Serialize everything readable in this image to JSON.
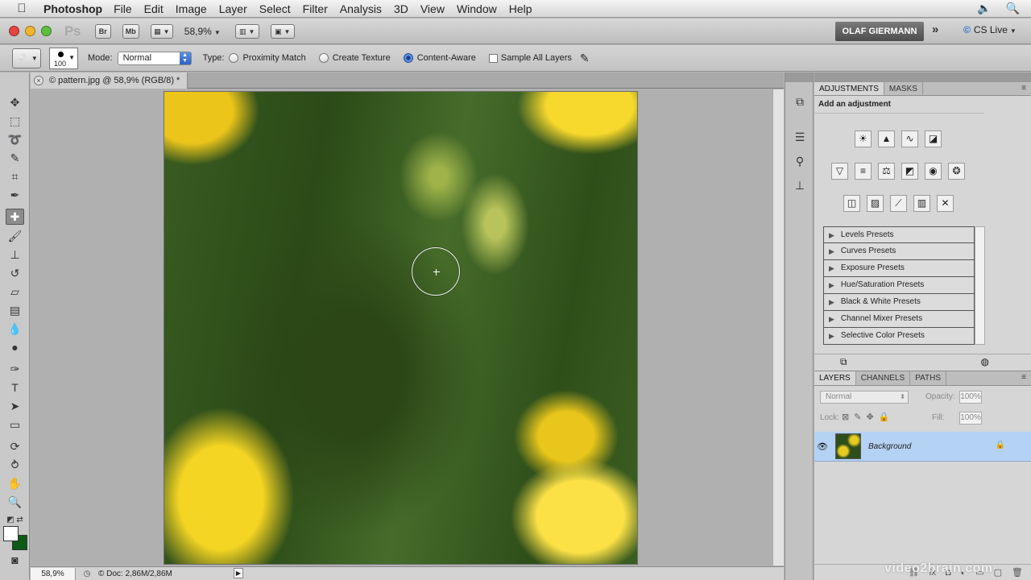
{
  "menubar": {
    "apple_icon": "apple-icon",
    "app_name": "Photoshop",
    "items": [
      "File",
      "Edit",
      "Image",
      "Layer",
      "Select",
      "Filter",
      "Analysis",
      "3D",
      "View",
      "Window",
      "Help"
    ],
    "volume_icon": "volume-icon",
    "search_icon": "spotlight-search-icon"
  },
  "appbar": {
    "ps_logo": "Ps",
    "bridge_label": "Br",
    "minibridge_label": "Mb",
    "zoom_level": "58,9%",
    "user_name": "OLAF GIERMANN",
    "expand_label": "»",
    "cs_live_label": "CS Live"
  },
  "options": {
    "brush_size": "100",
    "mode_label": "Mode:",
    "mode_value": "Normal",
    "type_label": "Type:",
    "types": [
      {
        "label": "Proximity Match",
        "checked": false
      },
      {
        "label": "Create Texture",
        "checked": false
      },
      {
        "label": "Content-Aware",
        "checked": true
      }
    ],
    "sample_all_layers_label": "Sample All Layers"
  },
  "document": {
    "tab_title": "© pattern.jpg @ 58,9% (RGB/8) *",
    "status_zoom": "58,9%",
    "status_doc": "© Doc: 2,86M/2,86M"
  },
  "colors": {
    "foreground": "#ffffff",
    "background": "#0d5a16",
    "selection_blue": "#b4d2f3"
  },
  "adjustments": {
    "tabs": [
      "ADJUSTMENTS",
      "MASKS"
    ],
    "title": "Add an adjustment",
    "presets": [
      "Levels Presets",
      "Curves Presets",
      "Exposure Presets",
      "Hue/Saturation Presets",
      "Black & White Presets",
      "Channel Mixer Presets",
      "Selective Color Presets"
    ]
  },
  "layers": {
    "tabs": [
      "LAYERS",
      "CHANNELS",
      "PATHS"
    ],
    "blend_mode": "Normal",
    "opacity_label": "Opacity:",
    "opacity_value": "100%",
    "lock_label": "Lock:",
    "fill_label": "Fill:",
    "fill_value": "100%",
    "items": [
      {
        "name": "Background",
        "visible": true,
        "locked": true
      }
    ]
  },
  "watermark": "video2brain.com"
}
